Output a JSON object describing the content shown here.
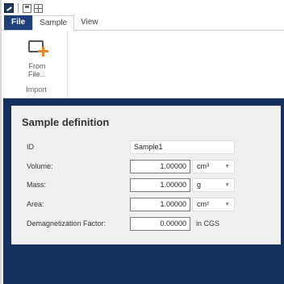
{
  "ribbon": {
    "tabs": [
      {
        "label": "File"
      },
      {
        "label": "Sample"
      },
      {
        "label": "View"
      }
    ],
    "from_file_label": "From\nFile...",
    "group_label": "Import"
  },
  "panel": {
    "title": "Sample definition",
    "id": {
      "label": "ID",
      "value": "Sample1"
    },
    "volume": {
      "label": "Volume:",
      "value": "1.00000",
      "unit": "cm³"
    },
    "mass": {
      "label": "Mass:",
      "value": "1.00000",
      "unit": "g"
    },
    "area": {
      "label": "Area:",
      "value": "1.00000",
      "unit": "cm²"
    },
    "demag": {
      "label": "Demagnetization Factor:",
      "value": "0.00000",
      "unit": "in CGS"
    }
  },
  "icons": [
    "app-icon",
    "save-icon",
    "layout-icon",
    "from-file-icon",
    "chevron-down-icon"
  ],
  "colors": {
    "file_tab": "#1f3f7a",
    "workspace": "#16305e",
    "panel": "#f0f0f0",
    "accent_plus": "#e8862a"
  }
}
